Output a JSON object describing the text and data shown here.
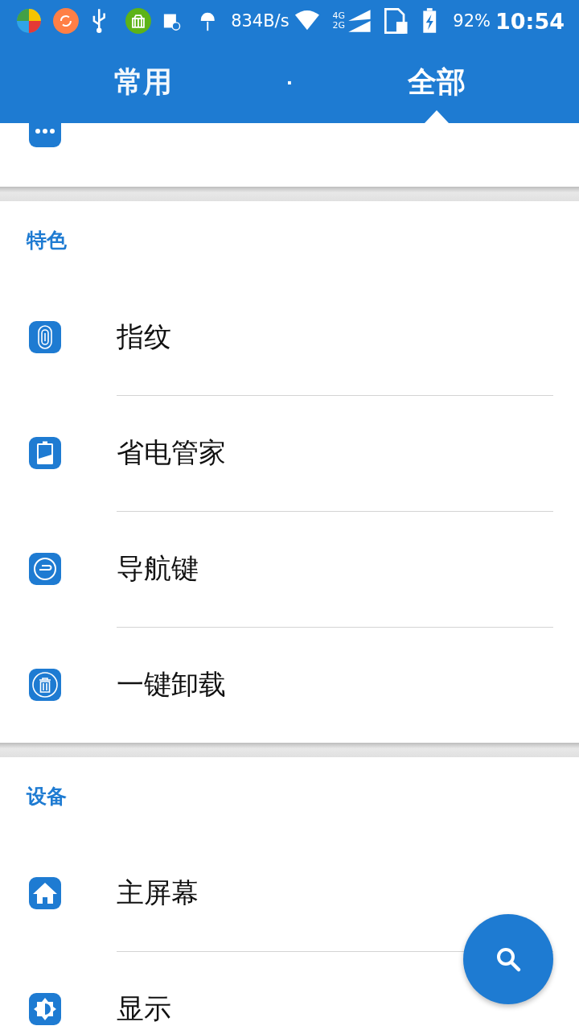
{
  "status_bar": {
    "net_speed": "834B/s",
    "network_top": "4G",
    "network_bottom": "2G",
    "battery": "92%",
    "time": "10:54"
  },
  "tabs": [
    {
      "label": "常用",
      "selected": false
    },
    {
      "label": "全部",
      "selected": true
    }
  ],
  "tab_separator": "·",
  "sections": [
    {
      "items": [
        {
          "kind": "more"
        }
      ]
    },
    {
      "title": "特色",
      "items": [
        {
          "kind": "fingerprint",
          "label": "指纹"
        },
        {
          "kind": "battery",
          "label": "省电管家"
        },
        {
          "kind": "navigation",
          "label": "导航键"
        },
        {
          "kind": "uninstall",
          "label": "一键卸载"
        }
      ]
    },
    {
      "title": "设备",
      "items": [
        {
          "kind": "home",
          "label": "主屏幕"
        },
        {
          "kind": "display",
          "label": "显示"
        }
      ]
    }
  ]
}
